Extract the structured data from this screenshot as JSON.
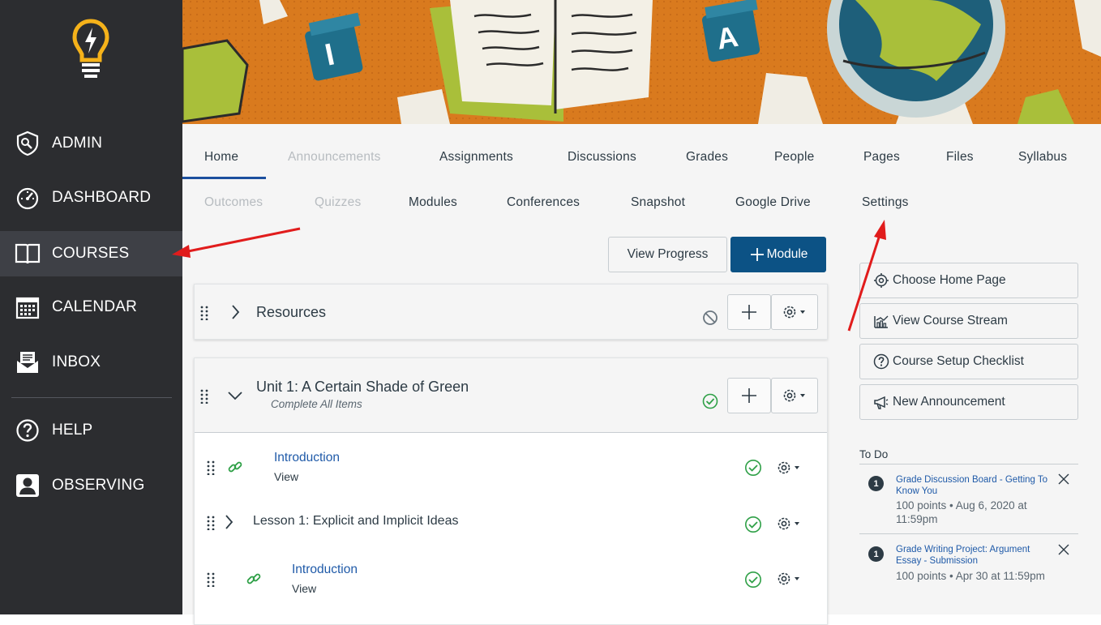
{
  "sidebar": {
    "items": [
      {
        "label": "ADMIN",
        "icon": "shield-icon"
      },
      {
        "label": "DASHBOARD",
        "icon": "dashboard-icon"
      },
      {
        "label": "COURSES",
        "icon": "book-icon"
      },
      {
        "label": "CALENDAR",
        "icon": "calendar-icon"
      },
      {
        "label": "INBOX",
        "icon": "inbox-icon"
      },
      {
        "label": "HELP",
        "icon": "help-icon"
      },
      {
        "label": "OBSERVING",
        "icon": "user-icon"
      }
    ],
    "active": "COURSES"
  },
  "tabs": {
    "row1": [
      {
        "label": "Home",
        "state": "active"
      },
      {
        "label": "Announcements",
        "state": "disabled"
      },
      {
        "label": "Assignments",
        "state": "enabled"
      },
      {
        "label": "Discussions",
        "state": "enabled"
      },
      {
        "label": "Grades",
        "state": "enabled"
      },
      {
        "label": "People",
        "state": "enabled"
      },
      {
        "label": "Pages",
        "state": "enabled"
      },
      {
        "label": "Files",
        "state": "enabled"
      },
      {
        "label": "Syllabus",
        "state": "enabled"
      }
    ],
    "row2": [
      {
        "label": "Outcomes",
        "state": "disabled"
      },
      {
        "label": "Quizzes",
        "state": "disabled"
      },
      {
        "label": "Modules",
        "state": "enabled"
      },
      {
        "label": "Conferences",
        "state": "enabled"
      },
      {
        "label": "Snapshot",
        "state": "enabled"
      },
      {
        "label": "Google Drive",
        "state": "enabled"
      },
      {
        "label": "Settings",
        "state": "enabled"
      }
    ]
  },
  "toolbar": {
    "view_progress": "View Progress",
    "add_module": "Module"
  },
  "modules": [
    {
      "title": "Resources",
      "requirement": "",
      "status": "unpublished"
    },
    {
      "title": "Unit 1: A Certain Shade of Green",
      "requirement": "Complete All Items",
      "status": "published"
    }
  ],
  "module_items": [
    {
      "title": "Introduction",
      "subtitle": "View",
      "type": "link"
    },
    {
      "title": "Lesson 1: Explicit and Implicit Ideas",
      "subtitle": "",
      "type": "subheader"
    },
    {
      "title": "Introduction",
      "subtitle": "View",
      "type": "link"
    }
  ],
  "course_actions": [
    {
      "label": "Choose Home Page",
      "icon": "target-icon"
    },
    {
      "label": "View Course Stream",
      "icon": "chart-icon"
    },
    {
      "label": "Course Setup Checklist",
      "icon": "question-icon"
    },
    {
      "label": "New Announcement",
      "icon": "megaphone-icon"
    }
  ],
  "todo": {
    "heading": "To Do",
    "items": [
      {
        "count": "1",
        "title": "Grade Discussion Board - Getting To Know You",
        "meta": "100 points • Aug 6, 2020 at 11:59pm"
      },
      {
        "count": "1",
        "title": "Grade Writing Project: Argument Essay - Submission",
        "meta": "100 points • Apr 30 at 11:59pm"
      }
    ]
  },
  "colors": {
    "sidebar": "#2c2d30",
    "primary": "#0c5285",
    "link": "#1f5aa8",
    "published": "#2fa047",
    "annotation_arrow": "#e11c1c",
    "banner": "#d97a1e"
  }
}
